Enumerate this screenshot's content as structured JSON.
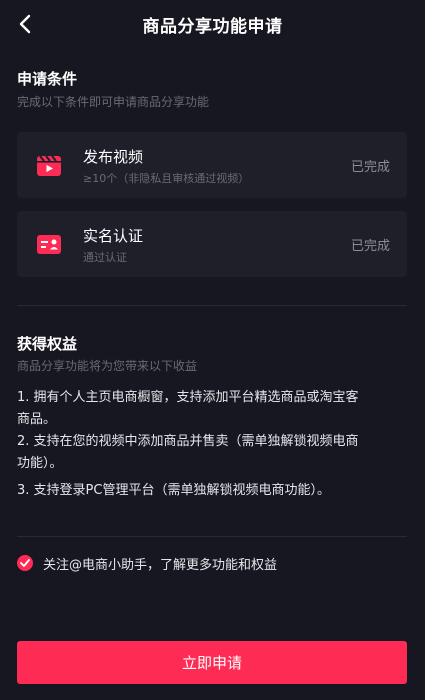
{
  "header": {
    "title": "商品分享功能申请"
  },
  "conditions": {
    "title": "申请条件",
    "subtitle": "完成以下条件即可申请商品分享功能",
    "items": [
      {
        "icon": "video-clapper-icon",
        "title": "发布视频",
        "desc": "≥10个（非隐私且审核通过视频）",
        "status": "已完成"
      },
      {
        "icon": "id-card-icon",
        "title": "实名认证",
        "desc": "通过认证",
        "status": "已完成"
      }
    ]
  },
  "benefits": {
    "title": "获得权益",
    "subtitle": "商品分享功能将为您带来以下收益",
    "items": [
      {
        "line1": "1. 拥有个人主页电商橱窗，支持添加平台精选商品或淘宝客",
        "line2": "商品。"
      },
      {
        "line1": "2. 支持在您的视频中添加商品并售卖（需单独解锁视频电商",
        "line2": "功能）。"
      },
      {
        "line1": "3. 支持登录PC管理平台（需单独解锁视频电商功能）。",
        "line2": ""
      }
    ]
  },
  "follow": {
    "text": "关注@电商小助手，了解更多功能和权益",
    "checked": true
  },
  "apply_button": {
    "label": "立即申请"
  },
  "colors": {
    "accent": "#fe2c55",
    "background": "#171721",
    "card": "#1f1f2a"
  }
}
